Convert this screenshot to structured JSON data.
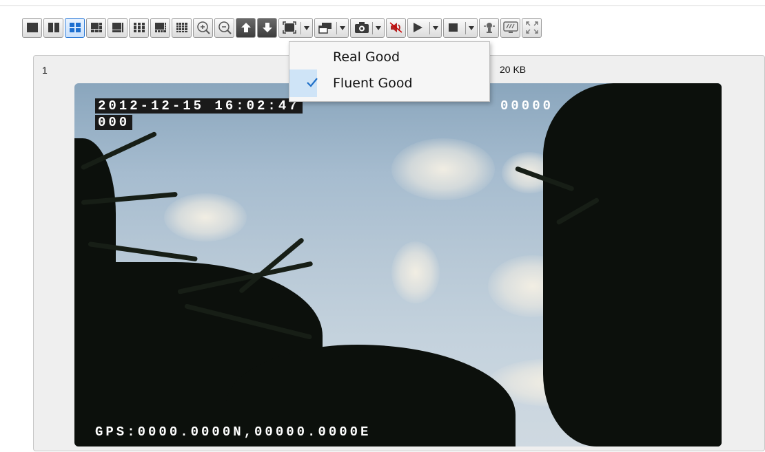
{
  "toolbar": {
    "buttons": [
      {
        "icon": "single-view-icon",
        "active": false
      },
      {
        "icon": "two-split-view-icon",
        "active": false
      },
      {
        "icon": "four-split-view-icon",
        "active": true
      },
      {
        "icon": "six-split-view-icon",
        "active": false
      },
      {
        "icon": "eight-split-view-icon",
        "active": false
      },
      {
        "icon": "nine-split-view-icon",
        "active": false
      },
      {
        "icon": "ten-split-view-icon",
        "active": false
      },
      {
        "icon": "sixteen-split-view-icon",
        "active": false
      },
      {
        "icon": "zoom-in-icon",
        "active": false
      },
      {
        "icon": "zoom-out-icon",
        "active": false
      },
      {
        "icon": "previous-page-icon",
        "active": false
      },
      {
        "icon": "next-page-icon",
        "active": false
      },
      {
        "icon": "stream-quality-icon",
        "dropdown": true
      },
      {
        "icon": "window-layout-icon",
        "dropdown": true
      },
      {
        "icon": "snapshot-camera-icon",
        "dropdown": true
      },
      {
        "icon": "speaker-mute-icon",
        "active": false
      },
      {
        "icon": "play-icon",
        "dropdown": true
      },
      {
        "icon": "stop-icon",
        "dropdown": true
      },
      {
        "icon": "intercom-icon",
        "active": false
      },
      {
        "icon": "monitor-icon",
        "active": false
      },
      {
        "icon": "fullscreen-icon",
        "active": false
      }
    ]
  },
  "panel": {
    "channel_number": "1",
    "bitrate": "20 KB"
  },
  "video": {
    "osd_datetime": "2012-12-15 16:02:47",
    "osd_id": "00000",
    "osd_id_line2": "000",
    "osd_gps": "GPS:0000.0000N,00000.0000E"
  },
  "dropdown": {
    "items": [
      {
        "label": "Real Good",
        "checked": false
      },
      {
        "label": "Fluent Good",
        "checked": true
      }
    ]
  },
  "colors": {
    "active_accent": "#2e7bd6",
    "check_accent": "#1e6fc8",
    "check_column": "#cfe4f7"
  }
}
